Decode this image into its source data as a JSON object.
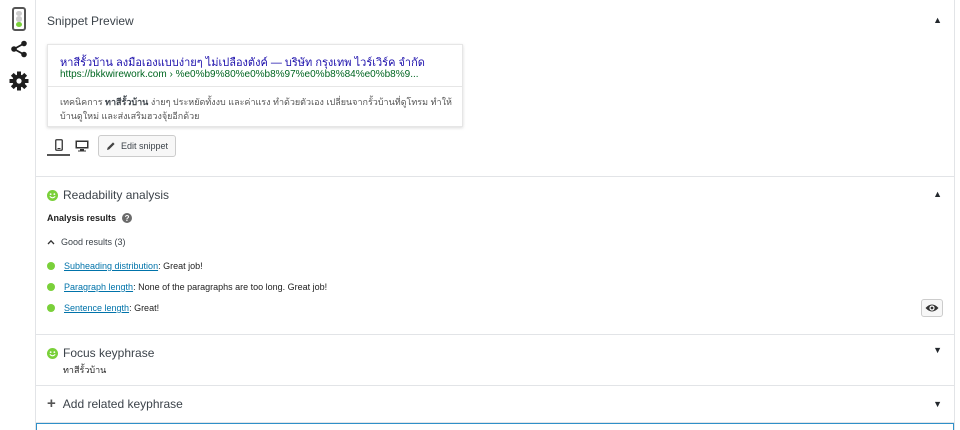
{
  "sidebar": {
    "items": [
      {
        "icon": "traffic-light-icon"
      },
      {
        "icon": "share-icon"
      },
      {
        "icon": "gear-icon"
      }
    ]
  },
  "snippet_preview": {
    "title": "Snippet Preview",
    "collapse_glyph": "▲",
    "serp_title": "หาสีรั้วบ้าน ลงมือเองแบบง่ายๆ ไม่เปลืองตังค์ — บริษัท กรุงเทพ ไวร์เวิร์ค จำกัด",
    "serp_url": "https://bkkwirework.com › %e0%b9%80%e0%b8%97%e0%b8%84%e0%b8%9...",
    "serp_desc_prefix": "เทคนิคการ ",
    "serp_desc_bold": "ทาสีรั้วบ้าน",
    "serp_desc_rest": " ง่ายๆ ประหยัดทั้งงบ และค่าแรง ทำด้วยตัวเอง เปลี่ยนจากรั้วบ้านที่ดูโทรม ทำให้บ้านดูใหม่ และส่งเสริมฮวงจุ้ยอีกด้วย",
    "edit_label": "Edit snippet"
  },
  "readability": {
    "title": "Readability analysis",
    "collapse_glyph": "▲",
    "analysis_label": "Analysis results",
    "help_glyph": "?",
    "good_label": "Good results (3)",
    "results": [
      {
        "link": "Subheading distribution",
        "text": ": Great job!"
      },
      {
        "link": "Paragraph length",
        "text": ": None of the paragraphs are too long. Great job!"
      },
      {
        "link": "Sentence length",
        "text": ": Great!"
      }
    ]
  },
  "focus_keyphrase": {
    "title": "Focus keyphrase",
    "value": "ทาสีรั้วบ้าน",
    "expand_glyph": "▼"
  },
  "related_keyphrase": {
    "title": "Add related keyphrase",
    "expand_glyph": "▼"
  },
  "colors": {
    "good": "#7ad03a",
    "link": "#0073aa",
    "serp_title": "#1a0dab",
    "serp_url": "#006621",
    "focus_border": "#2f90c9"
  }
}
